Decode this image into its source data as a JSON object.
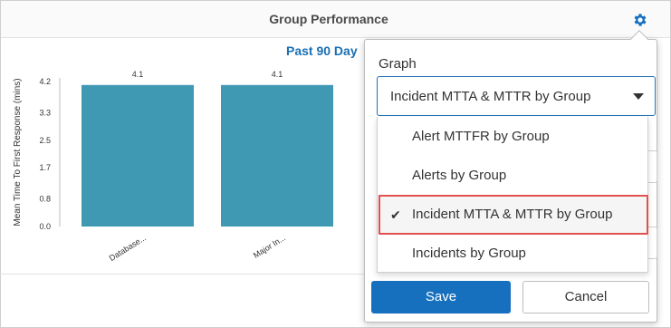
{
  "widget": {
    "title": "Group Performance",
    "settings_icon": "gear-icon"
  },
  "chart_data": {
    "type": "bar",
    "title": "Past 90 Day",
    "categories": [
      "Database...",
      "Major In..."
    ],
    "values": [
      4.1,
      4.1
    ],
    "data_labels": [
      "4.1",
      "4.1"
    ],
    "ylabel": "Mean Time To First Response (mins)",
    "yticks": [
      "4.2",
      "3.3",
      "2.5",
      "1.7",
      "0.8",
      "0.0"
    ],
    "ylim": [
      0,
      4.2
    ],
    "bar_color": "#3f99b3",
    "grid": false
  },
  "popover": {
    "graph_label": "Graph",
    "selected_value": "Incident MTTA & MTTR by Group",
    "options": [
      {
        "label": "Alert MTTFR by Group",
        "selected": false
      },
      {
        "label": "Alerts by Group",
        "selected": false
      },
      {
        "label": "Incident MTTA & MTTR by Group",
        "selected": true
      },
      {
        "label": "Incidents by Group",
        "selected": false
      }
    ],
    "check_glyph": "✔",
    "save_label": "Save",
    "cancel_label": "Cancel",
    "accent_color": "#1670bd",
    "highlight_color": "#e35050"
  }
}
